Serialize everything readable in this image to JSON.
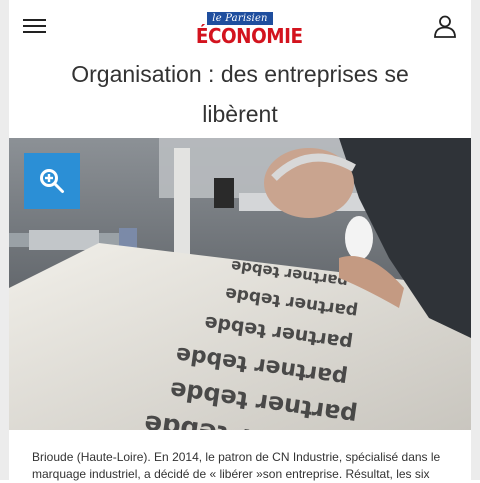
{
  "header": {
    "logo_top": "le Parisien",
    "logo_main": "ÉCONOMIE",
    "menu_icon": "hamburger-menu-icon",
    "account_icon": "user-account-icon"
  },
  "article": {
    "title_line1": "Organisation : des entreprises se",
    "title_line2": "libèrent",
    "caption": "Brioude (Haute-Loire). En 2014, le patron de CN Industrie, spécialisé dans le marquage industriel, a décidé de « libérer »son entreprise. Résultat, les six"
  },
  "photo": {
    "zoom_icon": "zoom-in-icon",
    "plate_text": [
      "partner tebde",
      "partner tebde",
      "partner tebde",
      "partner tebde",
      "partner tebde",
      "partner tebde"
    ]
  },
  "colors": {
    "brand_red": "#d3131e",
    "brand_blue": "#1f4e9e",
    "zoom_blue": "#2b8fd6",
    "text": "#333333"
  }
}
